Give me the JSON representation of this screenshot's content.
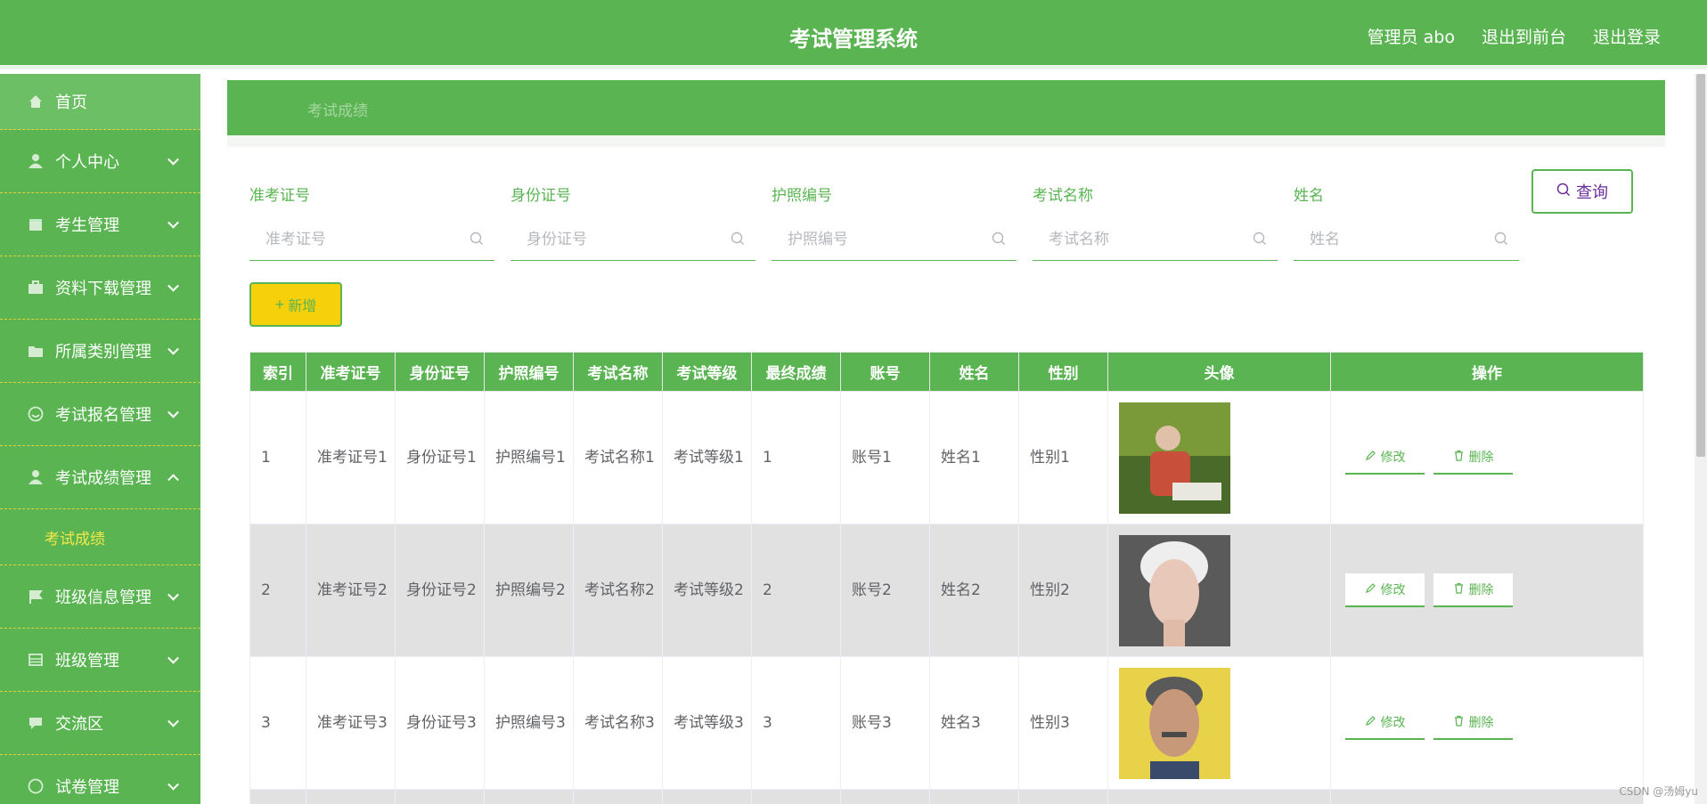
{
  "header": {
    "title": "考试管理系统",
    "admin_label": "管理员 abo",
    "exit_front": "退出到前台",
    "logout": "退出登录"
  },
  "sidebar": {
    "items": [
      {
        "label": "首页",
        "icon": "home-icon"
      },
      {
        "label": "个人中心",
        "icon": "user-icon"
      },
      {
        "label": "考生管理",
        "icon": "calendar-icon"
      },
      {
        "label": "资料下载管理",
        "icon": "briefcase-icon"
      },
      {
        "label": "所属类别管理",
        "icon": "folder-icon"
      },
      {
        "label": "考试报名管理",
        "icon": "smile-icon"
      },
      {
        "label": "考试成绩管理",
        "icon": "user-icon"
      },
      {
        "label": "班级信息管理",
        "icon": "flag-icon"
      },
      {
        "label": "班级管理",
        "icon": "table-icon"
      },
      {
        "label": "交流区",
        "icon": "comment-icon"
      },
      {
        "label": "试卷管理",
        "icon": "doc-icon"
      }
    ],
    "active_sub": "考试成绩"
  },
  "breadcrumb": "考试成绩",
  "search": {
    "fields": [
      {
        "label": "准考证号",
        "placeholder": "准考证号"
      },
      {
        "label": "身份证号",
        "placeholder": "身份证号"
      },
      {
        "label": "护照编号",
        "placeholder": "护照编号"
      },
      {
        "label": "考试名称",
        "placeholder": "考试名称"
      },
      {
        "label": "姓名",
        "placeholder": "姓名"
      }
    ],
    "query_button": "查询",
    "add_button": "新增"
  },
  "table": {
    "headers": [
      "索引",
      "准考证号",
      "身份证号",
      "护照编号",
      "考试名称",
      "考试等级",
      "最终成绩",
      "账号",
      "姓名",
      "性别",
      "头像",
      "操作"
    ],
    "rows": [
      {
        "index": "1",
        "exam_no": "准考证号1",
        "id_no": "身份证号1",
        "passport": "护照编号1",
        "exam_name": "考试名称1",
        "level": "考试等级1",
        "score": "1",
        "account": "账号1",
        "name": "姓名1",
        "gender": "性别1"
      },
      {
        "index": "2",
        "exam_no": "准考证号2",
        "id_no": "身份证号2",
        "passport": "护照编号2",
        "exam_name": "考试名称2",
        "level": "考试等级2",
        "score": "2",
        "account": "账号2",
        "name": "姓名2",
        "gender": "性别2"
      },
      {
        "index": "3",
        "exam_no": "准考证号3",
        "id_no": "身份证号3",
        "passport": "护照编号3",
        "exam_name": "考试名称3",
        "level": "考试等级3",
        "score": "3",
        "account": "账号3",
        "name": "姓名3",
        "gender": "性别3"
      }
    ],
    "edit_label": "修改",
    "delete_label": "删除"
  },
  "watermark": "CSDN @汤姆yu",
  "colors": {
    "primary": "#59b451",
    "accent_yellow": "#f6d00b",
    "row_alt": "#e1e1e1"
  }
}
